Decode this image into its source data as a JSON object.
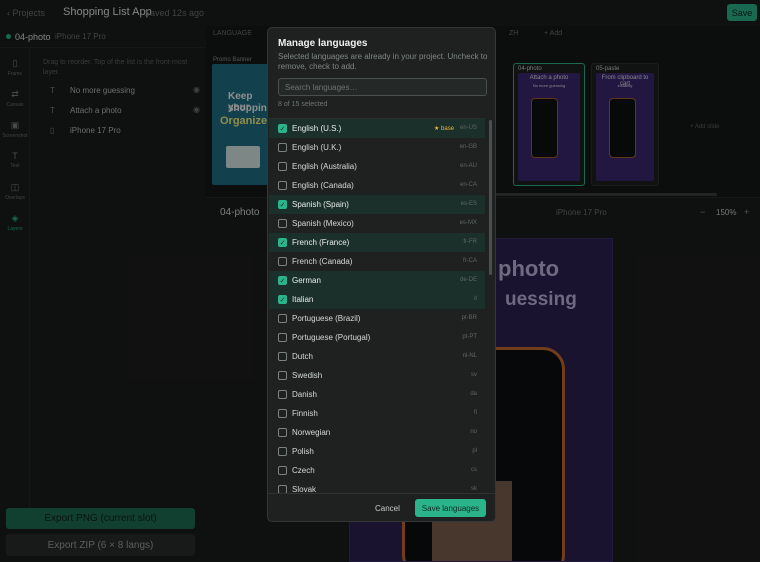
{
  "header": {
    "back_label": "‹ Projects",
    "app_title": "Shopping List App",
    "saved_status": "Saved 12s ago",
    "save_label": "Save"
  },
  "slot": {
    "name": "04-photo",
    "device": "iPhone 17 Pro"
  },
  "rail": [
    {
      "glyph": "▯",
      "label": "Frame"
    },
    {
      "glyph": "⇄",
      "label": "Canvas"
    },
    {
      "glyph": "▣",
      "label": "Screenshot"
    },
    {
      "glyph": "T",
      "label": "Text"
    },
    {
      "glyph": "◫",
      "label": "Overlays"
    },
    {
      "glyph": "◈",
      "label": "Layers"
    }
  ],
  "layers": {
    "hint": "Drag to reorder. Top of the list is the front-most layer.",
    "items": [
      {
        "glyph": "T",
        "label": "No more guessing"
      },
      {
        "glyph": "T",
        "label": "Attach a photo"
      },
      {
        "glyph": "▯",
        "label": "iPhone 17 Pro"
      }
    ]
  },
  "export": {
    "png_label": "Export PNG (current slot)",
    "zip_label": "Export ZIP (6 × 8 langs)"
  },
  "canvas": {
    "lang_tabs": [
      "LANGUAGE",
      "ZH",
      "+ Add"
    ],
    "promo_label": "Promo Banner",
    "promo_line1": "Keep your",
    "promo_line2": "shopping",
    "promo_line3": "Organized",
    "slides": [
      {
        "name": "04-photo",
        "cap1": "Attach a photo",
        "cap2": "No more guessing"
      },
      {
        "name": "05-paste",
        "cap1": "From clipboard to cart",
        "cap2": "instantly"
      }
    ],
    "add_slide": "+ Add slide"
  },
  "preview": {
    "title": "04-photo",
    "device": "iPhone 17 Pro",
    "zoom_minus": "−",
    "zoom": "150%",
    "zoom_plus": "+",
    "headline1": "photo",
    "headline2": "uessing"
  },
  "modal": {
    "title": "Manage languages",
    "description": "Selected languages are already in your project. Uncheck to remove, check to add.",
    "search_placeholder": "Search languages…",
    "count": "8 of 15 selected",
    "base_label": "★ base",
    "cancel_label": "Cancel",
    "save_label": "Save languages",
    "languages": [
      {
        "name": "English (U.S.)",
        "code": "en-US",
        "checked": true,
        "base": true
      },
      {
        "name": "English (U.K.)",
        "code": "en-GB",
        "checked": false
      },
      {
        "name": "English (Australia)",
        "code": "en-AU",
        "checked": false
      },
      {
        "name": "English (Canada)",
        "code": "en-CA",
        "checked": false
      },
      {
        "name": "Spanish (Spain)",
        "code": "es-ES",
        "checked": true
      },
      {
        "name": "Spanish (Mexico)",
        "code": "es-MX",
        "checked": false
      },
      {
        "name": "French (France)",
        "code": "fr-FR",
        "checked": true
      },
      {
        "name": "French (Canada)",
        "code": "fr-CA",
        "checked": false
      },
      {
        "name": "German",
        "code": "de-DE",
        "checked": true
      },
      {
        "name": "Italian",
        "code": "it",
        "checked": true
      },
      {
        "name": "Portuguese (Brazil)",
        "code": "pt-BR",
        "checked": false
      },
      {
        "name": "Portuguese (Portugal)",
        "code": "pt-PT",
        "checked": false
      },
      {
        "name": "Dutch",
        "code": "nl-NL",
        "checked": false
      },
      {
        "name": "Swedish",
        "code": "sv",
        "checked": false
      },
      {
        "name": "Danish",
        "code": "da",
        "checked": false
      },
      {
        "name": "Finnish",
        "code": "fi",
        "checked": false
      },
      {
        "name": "Norwegian",
        "code": "no",
        "checked": false
      },
      {
        "name": "Polish",
        "code": "pl",
        "checked": false
      },
      {
        "name": "Czech",
        "code": "cs",
        "checked": false
      },
      {
        "name": "Slovak",
        "code": "sk",
        "checked": false
      }
    ]
  },
  "colors": {
    "accent": "#2bb48a",
    "background": "#1b1d1c",
    "modal_bg": "#1e2120",
    "checked_row": "#1b302a",
    "base_star": "#e6b93e",
    "artboard": "#2c2152"
  }
}
